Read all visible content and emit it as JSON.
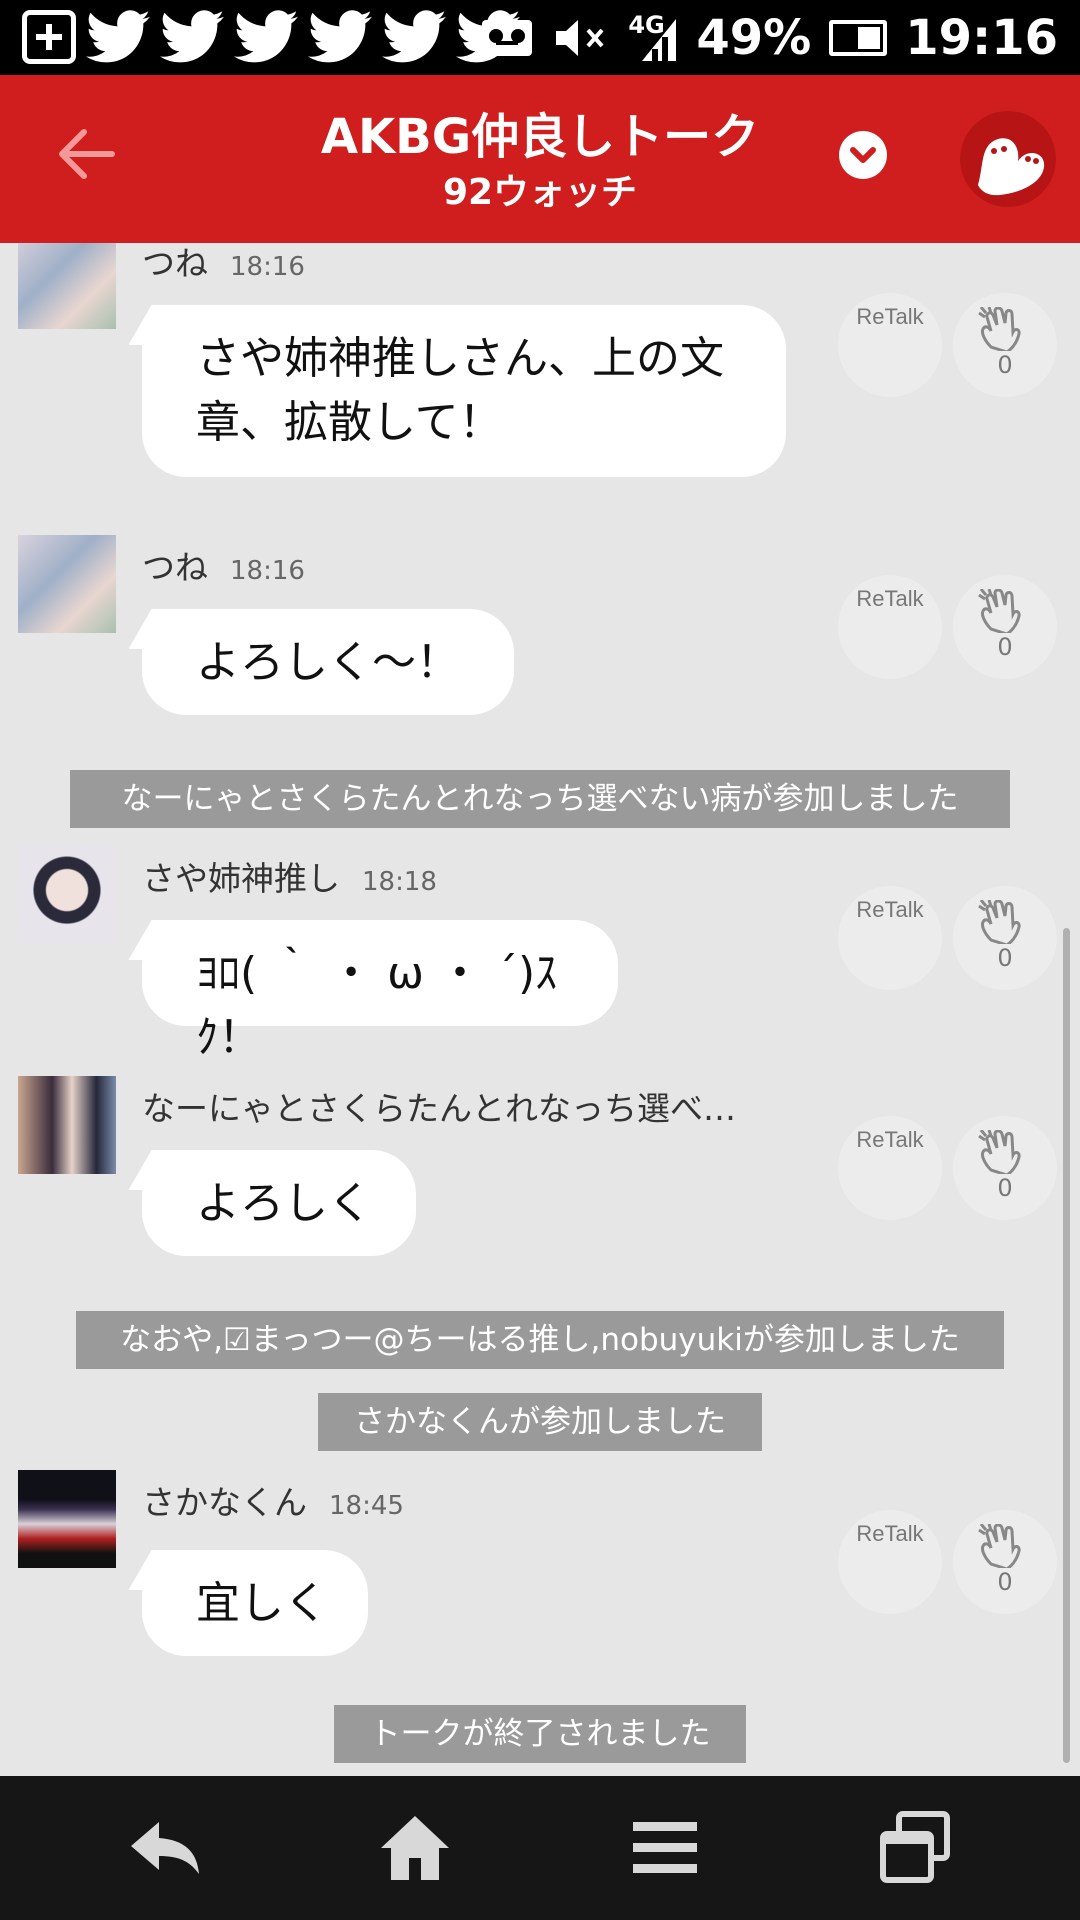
{
  "status_bar": {
    "battery": "49%",
    "battery_level": 0.49,
    "time": "19:16",
    "network": "4G",
    "icons": [
      "plus-box-icon",
      "twitter-icon",
      "twitter-icon",
      "twitter-icon",
      "twitter-icon",
      "twitter-icon",
      "twitter-icon",
      "voicemail-icon",
      "mute-icon",
      "signal-icon",
      "battery-icon"
    ]
  },
  "header": {
    "title": "AKBG仲良しトーク",
    "subtitle": "92ウォッチ",
    "colors": {
      "header_bg": "#d01e1e",
      "back_arrow": "#f29a9a"
    }
  },
  "messages": [
    {
      "name": "つね",
      "time": "18:16",
      "text_lines": [
        "さや姉神推しさん、上の文",
        "章、拡散して！"
      ],
      "retalk": "ReTalk",
      "claps": "0"
    },
    {
      "name": "つね",
      "time": "18:16",
      "text_lines": [
        "よろしく～！"
      ],
      "retalk": "ReTalk",
      "claps": "0"
    },
    {
      "name": "さや姉神推し",
      "time": "18:18",
      "text_lines": [
        "ﾖﾛ( ｀ ・ ω ・ ´)ｽｸ！"
      ],
      "retalk": "ReTalk",
      "claps": "0"
    },
    {
      "name": "なーにゃとさくらたんとれなっち選べ…",
      "time": "",
      "text_lines": [
        "よろしく"
      ],
      "retalk": "ReTalk",
      "claps": "0"
    },
    {
      "name": "さかなくん",
      "time": "18:45",
      "text_lines": [
        "宜しく"
      ],
      "retalk": "ReTalk",
      "claps": "0"
    }
  ],
  "system_messages": [
    "なーにゃとさくらたんとれなっち選べない病が参加しました",
    "なおや,☑まっつー@ちーはる推し,nobuyukiが参加しました",
    "さかなくんが参加しました",
    "トークが終了されました"
  ],
  "nav": {
    "icons": [
      "back-icon",
      "home-icon",
      "menu-icon",
      "recent-apps-icon"
    ]
  }
}
